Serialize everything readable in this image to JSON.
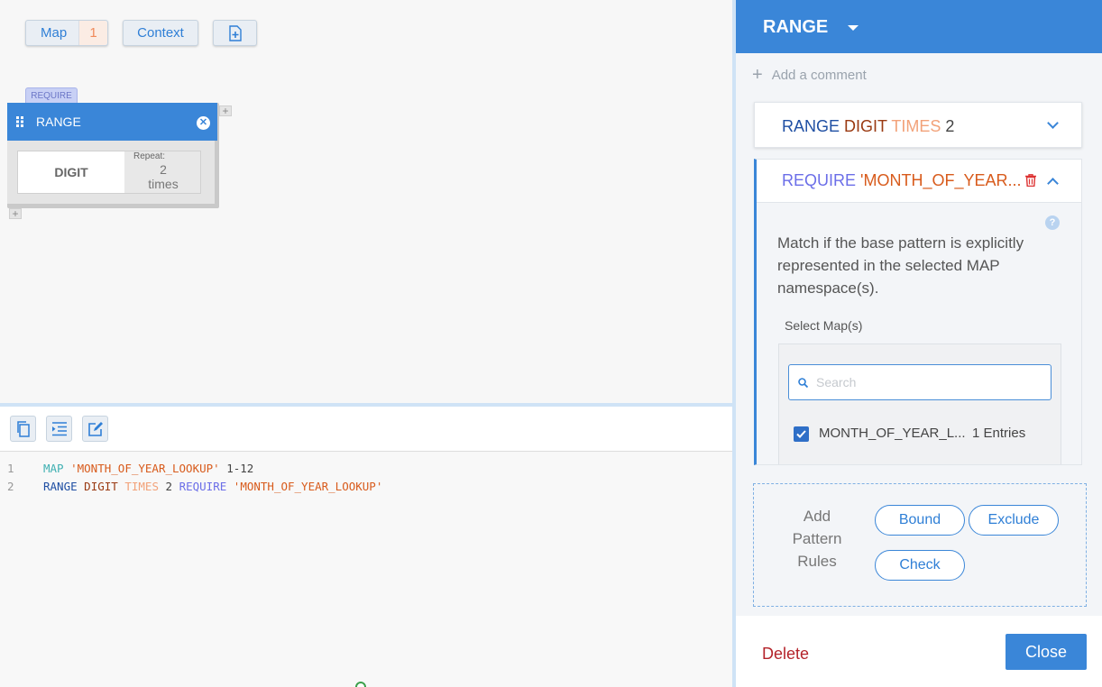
{
  "toolbar": {
    "map_label": "Map",
    "map_count": "1",
    "context_label": "Context"
  },
  "canvas": {
    "require_tag": "REQUIRE",
    "block_title": "RANGE",
    "digit_label": "DIGIT",
    "repeat_label": "Repeat:",
    "repeat_value": "2",
    "repeat_unit": "times"
  },
  "code": {
    "lines": [
      {
        "num": "1",
        "tokens": [
          "MAP",
          "'MONTH_OF_YEAR_LOOKUP'",
          "1-12"
        ]
      },
      {
        "num": "2",
        "tokens": [
          "RANGE",
          "DIGIT",
          "TIMES",
          "2",
          "REQUIRE",
          "'MONTH_OF_YEAR_LOOKUP'"
        ]
      }
    ]
  },
  "panel": {
    "title": "RANGE",
    "add_comment": "Add a comment",
    "card1": {
      "t1": "RANGE",
      "t2": "DIGIT",
      "t3": "TIMES",
      "t4": "2"
    },
    "card2": {
      "t1": "REQUIRE",
      "t2": "'MONTH_OF_YEAR...",
      "help": "?",
      "description": "Match if the base pattern is explicitly represented in the selected MAP namespace(s).",
      "select_label": "Select Map(s)",
      "search_placeholder": "Search",
      "map_name": "MONTH_OF_YEAR_L...",
      "map_entries": "1 Entries"
    },
    "rules_label": "Add Pattern Rules",
    "rules": {
      "bound": "Bound",
      "exclude": "Exclude",
      "check": "Check"
    },
    "delete_label": "Delete",
    "close_label": "Close"
  },
  "colors": {
    "accent": "#3a86d8",
    "danger": "#b4232a"
  }
}
